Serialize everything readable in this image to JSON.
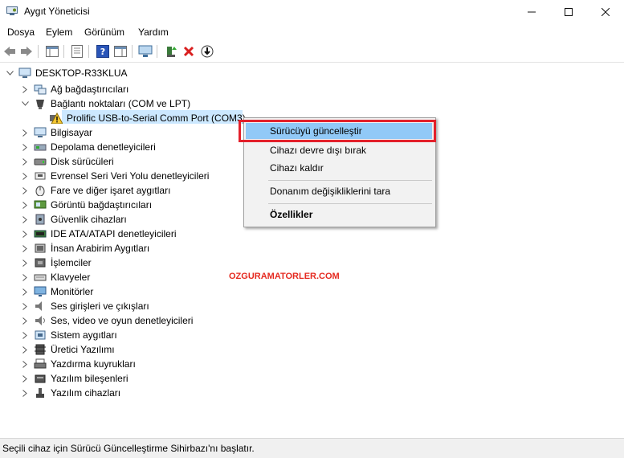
{
  "window": {
    "title": "Aygıt Yöneticisi"
  },
  "menu": [
    "Dosya",
    "Eylem",
    "Görünüm",
    "Yardım"
  ],
  "tree": {
    "root": "DESKTOP-R33KLUA",
    "items": [
      {
        "label": "Ağ bağdaştırıcıları",
        "expanded": false,
        "icon": "network-icon"
      },
      {
        "label": "Bağlantı noktaları (COM ve LPT)",
        "expanded": true,
        "icon": "port-icon"
      },
      {
        "label": "Prolific USB-to-Serial Comm Port (COM3)",
        "child": true,
        "icon": "warning-icon",
        "selected": true
      },
      {
        "label": "Bilgisayar",
        "expanded": false,
        "icon": "computer-icon"
      },
      {
        "label": "Depolama denetleyicileri",
        "expanded": false,
        "icon": "storage-icon"
      },
      {
        "label": "Disk sürücüleri",
        "expanded": false,
        "icon": "disk-icon"
      },
      {
        "label": "Evrensel Seri Veri Yolu denetleyicileri",
        "expanded": false,
        "icon": "usb-icon"
      },
      {
        "label": "Fare ve diğer işaret aygıtları",
        "expanded": false,
        "icon": "mouse-icon"
      },
      {
        "label": "Görüntü bağdaştırıcıları",
        "expanded": false,
        "icon": "display-adapter-icon"
      },
      {
        "label": "Güvenlik cihazları",
        "expanded": false,
        "icon": "security-icon"
      },
      {
        "label": "IDE ATA/ATAPI denetleyicileri",
        "expanded": false,
        "icon": "ide-icon"
      },
      {
        "label": "İnsan Arabirim Aygıtları",
        "expanded": false,
        "icon": "hid-icon"
      },
      {
        "label": "İşlemciler",
        "expanded": false,
        "icon": "processor-icon"
      },
      {
        "label": "Klavyeler",
        "expanded": false,
        "icon": "keyboard-icon"
      },
      {
        "label": "Monitörler",
        "expanded": false,
        "icon": "monitor-icon"
      },
      {
        "label": "Ses girişleri ve çıkışları",
        "expanded": false,
        "icon": "audio-icon"
      },
      {
        "label": "Ses, video ve oyun denetleyicileri",
        "expanded": false,
        "icon": "sound-video-icon"
      },
      {
        "label": "Sistem aygıtları",
        "expanded": false,
        "icon": "system-icon"
      },
      {
        "label": "Üretici Yazılımı",
        "expanded": false,
        "icon": "firmware-icon"
      },
      {
        "label": "Yazdırma kuyrukları",
        "expanded": false,
        "icon": "printer-icon"
      },
      {
        "label": "Yazılım bileşenleri",
        "expanded": false,
        "icon": "software-component-icon"
      },
      {
        "label": "Yazılım cihazları",
        "expanded": false,
        "icon": "software-device-icon"
      }
    ]
  },
  "context_menu": {
    "items": [
      {
        "label": "Sürücüyü güncelleştir",
        "highlighted": true
      },
      {
        "label": "Cihazı devre dışı bırak"
      },
      {
        "label": "Cihazı kaldır"
      },
      {
        "label": "Donanım değişikliklerini tara"
      },
      {
        "label": "Özellikler",
        "bold": true
      }
    ]
  },
  "watermark": "OZGURAMATORLER.COM",
  "status": "Seçili cihaz için Sürücü Güncelleştirme Sihirbazı'nı başlatır.",
  "colors": {
    "highlight": "#91c9f7",
    "selection": "#cce8ff",
    "annotation": "#e3202b"
  }
}
